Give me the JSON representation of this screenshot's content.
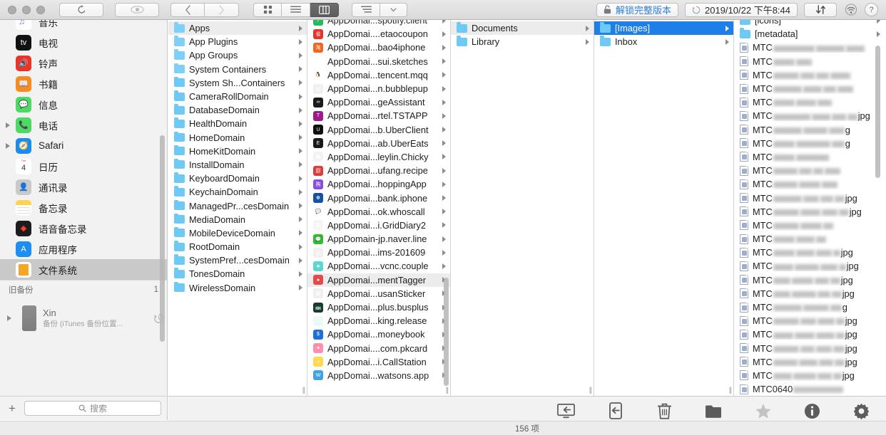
{
  "window": {
    "traffic_lights": [
      "close",
      "minimize",
      "zoom"
    ],
    "toolbar": {
      "refresh_label": "refresh-icon",
      "eye_label": "eye-icon",
      "back_label": "back-icon",
      "forward_label": "forward-icon",
      "view_grid_label": "grid-view-icon",
      "view_list_label": "list-view-icon",
      "view_column_label": "column-view-icon",
      "sort_label": "sort-icon",
      "sort_chevron": "chevron-down-icon",
      "unlock_label": "解锁完整版本",
      "lock_icon": "lock-icon",
      "history_icon": "history-icon",
      "timestamp": "2019/10/22 下午8:44",
      "transfer_label": "transfer-icon",
      "wifi_label": "wifi-icon",
      "help_label": "?"
    }
  },
  "sidebar": {
    "items": [
      {
        "label": "音乐",
        "icon": "music-app-icon",
        "bg": "#ffffff",
        "fg": "#a35ce0",
        "glyph": "♫",
        "disclosure": false,
        "selected": false,
        "partial": true
      },
      {
        "label": "电视",
        "icon": "tv-app-icon",
        "bg": "#111111",
        "fg": "#ffffff",
        "glyph": "tv",
        "disclosure": false,
        "selected": false
      },
      {
        "label": "铃声",
        "icon": "ringtones-app-icon",
        "bg": "#e8342b",
        "fg": "#ffffff",
        "glyph": "🔊",
        "disclosure": false,
        "selected": false
      },
      {
        "label": "书籍",
        "icon": "books-app-icon",
        "bg": "#f68b1f",
        "fg": "#ffffff",
        "glyph": "📖",
        "disclosure": false,
        "selected": false
      },
      {
        "label": "信息",
        "icon": "messages-app-icon",
        "bg": "#4cd964",
        "fg": "#ffffff",
        "glyph": "💬",
        "disclosure": false,
        "selected": false
      },
      {
        "label": "电话",
        "icon": "phone-app-icon",
        "bg": "#4cd964",
        "fg": "#ffffff",
        "glyph": "📞",
        "disclosure": true,
        "selected": false
      },
      {
        "label": "Safari",
        "icon": "safari-app-icon",
        "bg": "#1b8bf0",
        "fg": "#ffffff",
        "glyph": "🧭",
        "disclosure": true,
        "selected": false
      },
      {
        "label": "日历",
        "icon": "calendar-app-icon",
        "bg": "#ffffff",
        "fg": "#e8342b",
        "glyph": "4",
        "disclosure": false,
        "selected": false
      },
      {
        "label": "通讯录",
        "icon": "contacts-app-icon",
        "bg": "#c9c9c9",
        "fg": "#ffffff",
        "glyph": "👤",
        "disclosure": false,
        "selected": false
      },
      {
        "label": "备忘录",
        "icon": "notes-app-icon",
        "bg": "#ffd34e",
        "fg": "#ffffff",
        "glyph": "",
        "disclosure": false,
        "selected": false
      },
      {
        "label": "语音备忘录",
        "icon": "voice-memos-app-icon",
        "bg": "#1c1c1e",
        "fg": "#ff3b30",
        "glyph": "◆",
        "disclosure": false,
        "selected": false
      },
      {
        "label": "应用程序",
        "icon": "app-store-icon",
        "bg": "#1e8ff0",
        "fg": "#ffffff",
        "glyph": "A",
        "disclosure": false,
        "selected": false
      },
      {
        "label": "文件系统",
        "icon": "file-system-icon",
        "bg": "#ffffff",
        "fg": "#f6a623",
        "glyph": "▤",
        "disclosure": false,
        "selected": true
      }
    ],
    "section": {
      "title": "旧备份",
      "count": "1"
    },
    "backup": {
      "name": "Xin",
      "subtitle": "备份 (iTunes 备份位置...",
      "restore_icon": "history-icon",
      "disclosure": true
    },
    "footer": {
      "add_label": "+",
      "search_placeholder": "搜索",
      "search_icon": "search-icon"
    }
  },
  "columns": [
    {
      "name": "domains-column",
      "rows": [
        {
          "label": "Apps",
          "type": "folder-alt",
          "arrow": true,
          "state": "sel-grey"
        },
        {
          "label": "App Plugins",
          "type": "folder-alt",
          "arrow": true
        },
        {
          "label": "App Groups",
          "type": "folder-alt2",
          "arrow": true
        },
        {
          "label": "System Containers",
          "type": "folder-alt",
          "arrow": true
        },
        {
          "label": "System Sh...Containers",
          "type": "folder",
          "arrow": true
        },
        {
          "label": "CameraRollDomain",
          "type": "folder",
          "arrow": true
        },
        {
          "label": "DatabaseDomain",
          "type": "folder",
          "arrow": true
        },
        {
          "label": "HealthDomain",
          "type": "folder",
          "arrow": true
        },
        {
          "label": "HomeDomain",
          "type": "folder",
          "arrow": true
        },
        {
          "label": "HomeKitDomain",
          "type": "folder",
          "arrow": true
        },
        {
          "label": "InstallDomain",
          "type": "folder",
          "arrow": true
        },
        {
          "label": "KeyboardDomain",
          "type": "folder",
          "arrow": true
        },
        {
          "label": "KeychainDomain",
          "type": "folder",
          "arrow": true
        },
        {
          "label": "ManagedPr...cesDomain",
          "type": "folder",
          "arrow": true
        },
        {
          "label": "MediaDomain",
          "type": "folder",
          "arrow": true
        },
        {
          "label": "MobileDeviceDomain",
          "type": "folder",
          "arrow": true
        },
        {
          "label": "RootDomain",
          "type": "folder",
          "arrow": true
        },
        {
          "label": "SystemPref...cesDomain",
          "type": "folder",
          "arrow": true
        },
        {
          "label": "TonesDomain",
          "type": "folder",
          "arrow": true
        },
        {
          "label": "WirelessDomain",
          "type": "folder",
          "arrow": true
        }
      ]
    },
    {
      "name": "apps-column",
      "rows": [
        {
          "label": "AppDomai...spotify.client",
          "type": "app",
          "bg": "#1db954",
          "glyph": "♪",
          "arrow": true,
          "partial": true
        },
        {
          "label": "AppDomai....etaocoupon",
          "type": "app",
          "bg": "#e8332a",
          "glyph": "省",
          "arrow": true
        },
        {
          "label": "AppDomai...bao4iphone",
          "type": "app",
          "bg": "#f26522",
          "glyph": "淘",
          "arrow": true
        },
        {
          "label": "AppDomai...sui.sketches",
          "type": "app",
          "bg": "#ffffff",
          "glyph": "✎",
          "arrow": true
        },
        {
          "label": "AppDomai...tencent.mqq",
          "type": "app",
          "bg": "#ffffff",
          "glyph": "🐧",
          "arrow": true
        },
        {
          "label": "AppDomai...n.bubblepup",
          "type": "app",
          "bg": "#f0f0f0",
          "glyph": "▥",
          "arrow": true
        },
        {
          "label": "AppDomai...geAssistant",
          "type": "app",
          "bg": "#1a1a1a",
          "glyph": "∞",
          "arrow": true
        },
        {
          "label": "AppDomai...rtel.TSTAPP",
          "type": "app",
          "bg": "#9b1b8c",
          "glyph": "T",
          "arrow": true
        },
        {
          "label": "AppDomai...b.UberClient",
          "type": "app",
          "bg": "#101010",
          "glyph": "U",
          "arrow": true
        },
        {
          "label": "AppDomai...ab.UberEats",
          "type": "app",
          "bg": "#1a1a1a",
          "glyph": "E",
          "arrow": true
        },
        {
          "label": "AppDomai...leylin.Chicky",
          "type": "app",
          "bg": "#f2f2f2",
          "glyph": "▦",
          "arrow": true
        },
        {
          "label": "AppDomai...ufang.recipe",
          "type": "app",
          "bg": "#e03a3a",
          "glyph": "厨",
          "arrow": true
        },
        {
          "label": "AppDomai...hoppingApp",
          "type": "app",
          "bg": "#8a4fe0",
          "glyph": "购",
          "arrow": true
        },
        {
          "label": "AppDomai...bank.iphone",
          "type": "app",
          "bg": "#1453a3",
          "glyph": "☸",
          "arrow": true
        },
        {
          "label": "AppDomai...ok.whoscall",
          "type": "app",
          "bg": "#ffffff",
          "glyph": "💬",
          "arrow": true
        },
        {
          "label": "AppDomai...i.GridDiary2",
          "type": "app",
          "bg": "#f5f5f5",
          "glyph": "▤",
          "arrow": true
        },
        {
          "label": "AppDomain-jp.naver.line",
          "type": "app",
          "bg": "#2cbf2c",
          "glyph": "💬",
          "arrow": true
        },
        {
          "label": "AppDomai...ims-201609",
          "type": "app",
          "bg": "#f0f0f0",
          "glyph": "▥",
          "arrow": true
        },
        {
          "label": "AppDomai....vcnc.couple",
          "type": "app",
          "bg": "#5ed6d0",
          "glyph": "★",
          "arrow": true
        },
        {
          "label": "AppDomai...mentTagger",
          "type": "app",
          "bg": "#e24b4b",
          "glyph": "●",
          "arrow": true,
          "state": "sel-grey"
        },
        {
          "label": "AppDomai...usanSticker",
          "type": "app",
          "bg": "#efefef",
          "glyph": "▩",
          "arrow": true
        },
        {
          "label": "AppDomai...plus.busplus",
          "type": "app",
          "bg": "#1a3a2a",
          "glyph": "🚌",
          "arrow": true
        },
        {
          "label": "AppDomai...king.release",
          "type": "app",
          "bg": "#eafafa",
          "glyph": "◔",
          "arrow": true
        },
        {
          "label": "AppDomai...moneybook",
          "type": "app",
          "bg": "#1e6fd9",
          "glyph": "$",
          "arrow": true
        },
        {
          "label": "AppDomai....com.pkcard",
          "type": "app",
          "bg": "#ff8fb0",
          "glyph": "✦",
          "arrow": true
        },
        {
          "label": "AppDomai...i.CallStation",
          "type": "app",
          "bg": "#ffd84e",
          "glyph": "☺",
          "arrow": true
        },
        {
          "label": "AppDomai...watsons.app",
          "type": "app",
          "bg": "#3aa0e0",
          "glyph": "W",
          "arrow": true,
          "partial": true
        }
      ]
    },
    {
      "name": "container-column",
      "rows": [
        {
          "label": "Documents",
          "type": "folder",
          "arrow": true,
          "state": "sel-grey"
        },
        {
          "label": "Library",
          "type": "folder",
          "arrow": true
        }
      ]
    },
    {
      "name": "documents-column",
      "rows": [
        {
          "label": "[Images]",
          "type": "folder",
          "arrow": true,
          "state": "sel-blue"
        },
        {
          "label": "Inbox",
          "type": "folder",
          "arrow": true
        }
      ]
    },
    {
      "name": "images-column",
      "rows": [
        {
          "label": "[icons]",
          "type": "folder",
          "arrow": true
        },
        {
          "label": "[metadata]",
          "type": "folder",
          "arrow": true
        },
        {
          "label": "MTC",
          "type": "file",
          "redacted": [
            58,
            40,
            26
          ],
          "suffix": ""
        },
        {
          "label": "MTC",
          "type": "file",
          "redacted": [
            30,
            22
          ],
          "suffix": ""
        },
        {
          "label": "MTC",
          "type": "file",
          "redacted": [
            36,
            20,
            18,
            28
          ],
          "suffix": ""
        },
        {
          "label": "MTC",
          "type": "file",
          "redacted": [
            40,
            26,
            18,
            22
          ],
          "suffix": ""
        },
        {
          "label": "MTC",
          "type": "file",
          "redacted": [
            30,
            28,
            20
          ],
          "suffix": ""
        },
        {
          "label": "MTC",
          "type": "file",
          "redacted": [
            52,
            26,
            20,
            14
          ],
          "suffix": "jpg"
        },
        {
          "label": "MTC",
          "type": "file",
          "redacted": [
            40,
            34,
            22
          ],
          "suffix": "g"
        },
        {
          "label": "MTC",
          "type": "file",
          "redacted": [
            30,
            48,
            18
          ],
          "suffix": "g"
        },
        {
          "label": "MTC",
          "type": "file",
          "redacted": [
            30,
            46
          ],
          "suffix": ""
        },
        {
          "label": "MTC",
          "type": "file",
          "redacted": [
            34,
            18,
            14,
            22
          ],
          "suffix": ""
        },
        {
          "label": "MTC",
          "type": "file",
          "redacted": [
            34,
            30,
            22
          ],
          "suffix": ""
        },
        {
          "label": "MTC",
          "type": "file",
          "redacted": [
            40,
            22,
            18,
            14
          ],
          "suffix": "jpg"
        },
        {
          "label": "MTC",
          "type": "file",
          "redacted": [
            36,
            28,
            22,
            14
          ],
          "suffix": "jpg"
        },
        {
          "label": "MTC",
          "type": "file",
          "redacted": [
            36,
            30,
            14
          ],
          "suffix": ""
        },
        {
          "label": "MTC",
          "type": "file",
          "redacted": [
            30,
            26,
            14
          ],
          "suffix": ""
        },
        {
          "label": "MTC",
          "type": "file",
          "redacted": [
            30,
            26,
            22,
            10
          ],
          "suffix": "jpg"
        },
        {
          "label": "MTC",
          "type": "file",
          "redacted": [
            28,
            34,
            24,
            10
          ],
          "suffix": "jpg"
        },
        {
          "label": "MTC",
          "type": "file",
          "redacted": [
            24,
            30,
            20,
            14
          ],
          "suffix": "jpg"
        },
        {
          "label": "MTC",
          "type": "file",
          "redacted": [
            24,
            34,
            18,
            14
          ],
          "suffix": "jpg"
        },
        {
          "label": "MTC",
          "type": "file",
          "redacted": [
            40,
            36,
            16
          ],
          "suffix": "g"
        },
        {
          "label": "MTC",
          "type": "file",
          "redacted": [
            36,
            22,
            24,
            12
          ],
          "suffix": "jpg"
        },
        {
          "label": "MTC",
          "type": "file",
          "redacted": [
            28,
            28,
            26,
            12
          ],
          "suffix": "jpg"
        },
        {
          "label": "MTC",
          "type": "file",
          "redacted": [
            36,
            20,
            22,
            16
          ],
          "suffix": "jpg"
        },
        {
          "label": "MTC",
          "type": "file",
          "redacted": [
            34,
            26,
            20,
            14
          ],
          "suffix": "jpg"
        },
        {
          "label": "MTC",
          "type": "file",
          "redacted": [
            26,
            32,
            20,
            12
          ],
          "suffix": "jpg"
        },
        {
          "label": "MTC0640",
          "type": "file",
          "redacted": [
            70
          ],
          "suffix": "",
          "partial": true
        }
      ]
    }
  ],
  "bottom_actions": [
    {
      "label": "拷贝至 Mac",
      "icon": "copy-to-mac-icon",
      "disabled": false
    },
    {
      "label": "拷贝至备份",
      "icon": "copy-to-backup-icon",
      "disabled": false
    },
    {
      "label": "删除",
      "icon": "trash-icon",
      "disabled": false
    },
    {
      "label": "新建文件夹",
      "icon": "new-folder-icon",
      "disabled": false
    },
    {
      "label": "新快捷方式",
      "icon": "new-shortcut-star-icon",
      "disabled": true
    },
    {
      "label": "显示简介",
      "icon": "info-icon",
      "disabled": false
    },
    {
      "label": "选项",
      "icon": "gear-icon",
      "disabled": false
    }
  ],
  "status": {
    "item_count": "156 项"
  }
}
